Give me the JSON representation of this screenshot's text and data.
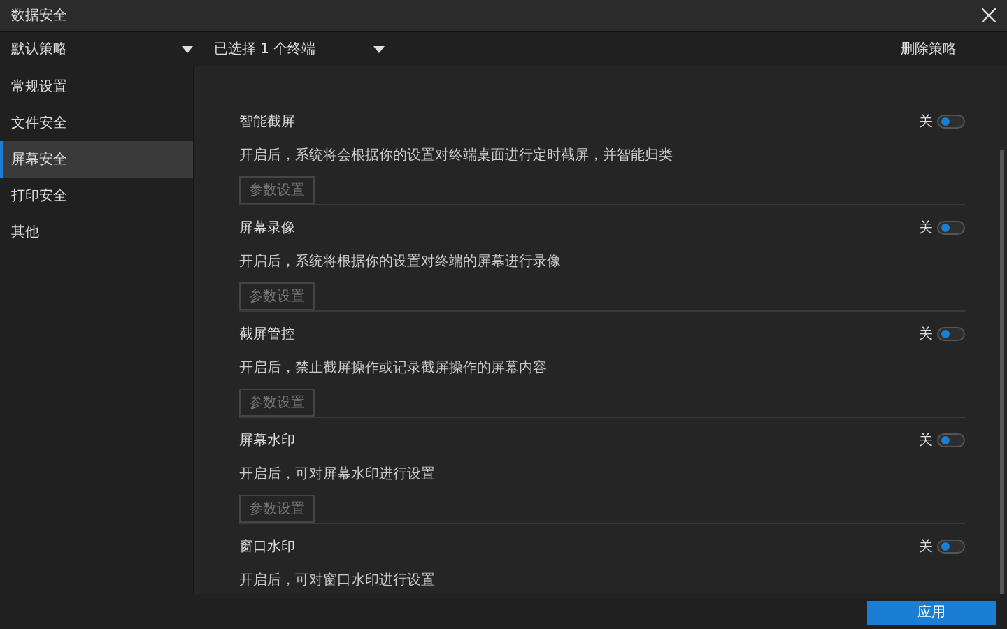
{
  "window": {
    "title": "数据安全"
  },
  "toolbar": {
    "policy": "默认策略",
    "terminals": "已选择 1 个终端",
    "delete": "删除策略"
  },
  "sidebar": {
    "items": [
      {
        "label": "常规设置",
        "selected": false
      },
      {
        "label": "文件安全",
        "selected": false
      },
      {
        "label": "屏幕安全",
        "selected": true
      },
      {
        "label": "打印安全",
        "selected": false
      },
      {
        "label": "其他",
        "selected": false
      }
    ]
  },
  "sections": [
    {
      "title": "智能截屏",
      "state_label": "关",
      "on": false,
      "description": "开启后，系统将会根据你的设置对终端桌面进行定时截屏，并智能归类",
      "button": "参数设置"
    },
    {
      "title": "屏幕录像",
      "state_label": "关",
      "on": false,
      "description": "开启后，系统将根据你的设置对终端的屏幕进行录像",
      "button": "参数设置"
    },
    {
      "title": "截屏管控",
      "state_label": "关",
      "on": false,
      "description": "开启后，禁止截屏操作或记录截屏操作的屏幕内容",
      "button": "参数设置"
    },
    {
      "title": "屏幕水印",
      "state_label": "关",
      "on": false,
      "description": "开启后，可对屏幕水印进行设置",
      "button": "参数设置"
    },
    {
      "title": "窗口水印",
      "state_label": "关",
      "on": false,
      "description": "开启后，可对窗口水印进行设置"
    }
  ],
  "footer": {
    "apply": "应用"
  }
}
